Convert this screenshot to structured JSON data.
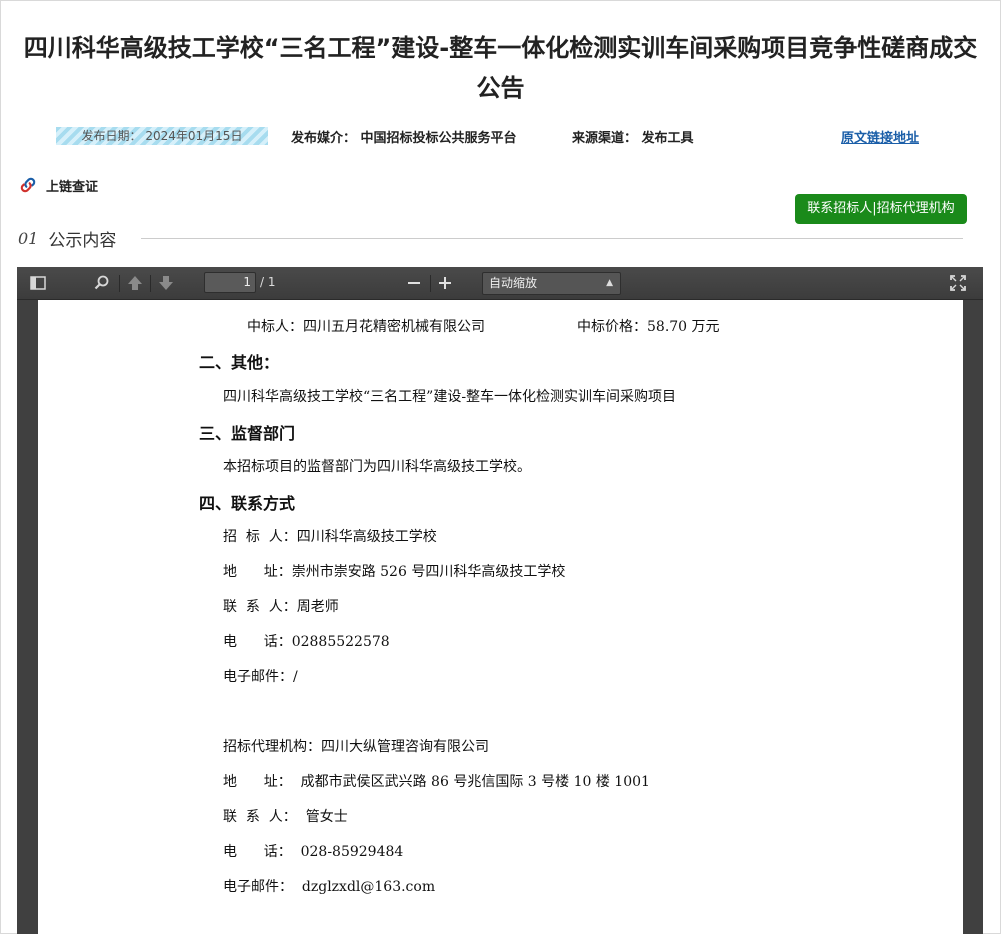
{
  "title": {
    "line1": "四川科华高级技工学校“三名工程”建设-整车一体化检测实训车间采购项目竞争性磋商成交",
    "line2": "公告"
  },
  "meta": {
    "date": "发布日期：  2024年01月15日",
    "media": "发布媒介：  中国招标投标公共服务平台",
    "source": "来源渠道：  发布工具",
    "original_link": "原文链接地址"
  },
  "chain_label": "上链查证",
  "contact_button": "联系招标人|招标代理机构",
  "section": {
    "num": "01",
    "label": "公示内容"
  },
  "pdf_toolbar": {
    "page_value": "1",
    "page_total": "/ 1",
    "zoom_selected": "自动缩放"
  },
  "document": {
    "winner_line": "中标人：四川五月花精密机械有限公司",
    "price_line": "中标价格：58.70 万元",
    "h_other": "二、其他：",
    "other_text": "四川科华高级技工学校“三名工程”建设-整车一体化检测实训车间采购项目",
    "h_supervision": "三、监督部门",
    "supervision_text": "本招标项目的监督部门为四川科华高级技工学校。",
    "h_contact": "四、联系方式",
    "tenderer": "招  标  人：四川科华高级技工学校",
    "tenderer_addr": "地      址：崇州市崇安路 526 号四川科华高级技工学校",
    "tenderer_contact": "联  系  人：周老师",
    "tenderer_phone": "电      话：02885522578",
    "tenderer_email": "电子邮件：/",
    "agency": "招标代理机构：四川大纵管理咨询有限公司",
    "agency_addr": "地      址：  成都市武侯区武兴路 86 号兆信国际 3 号楼 10 楼 1001",
    "agency_contact": "联  系  人：  管女士",
    "agency_phone": "电      话：  028-85929484",
    "agency_email": "电子邮件：  dzglzxdl@163.com"
  }
}
